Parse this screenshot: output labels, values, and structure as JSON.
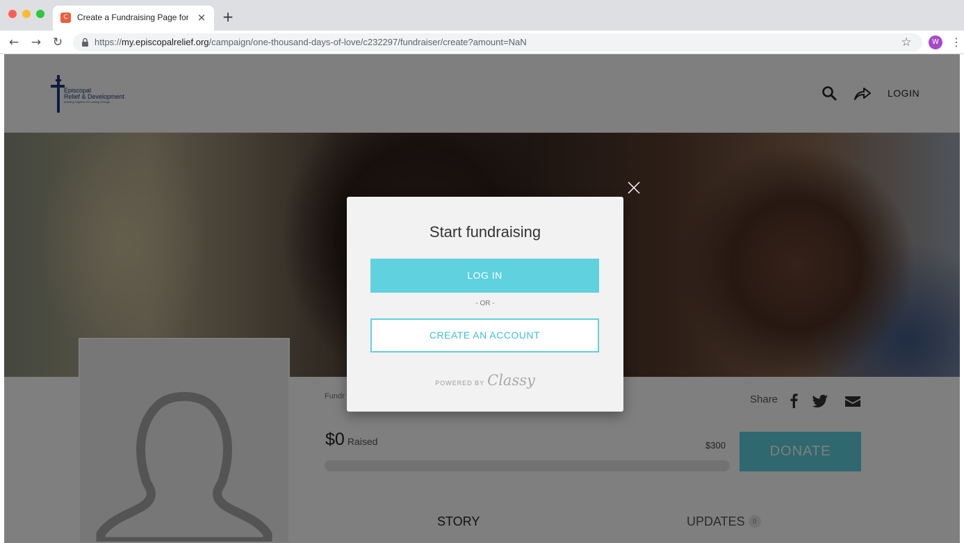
{
  "browser": {
    "tab_title": "Create a Fundraising Page for",
    "tab_close": "×",
    "new_tab": "+",
    "favicon_text": "C",
    "url_prefix": "https://",
    "url_domain": "my.episcopalrelief.org",
    "url_path": "/campaign/one-thousand-days-of-love/c232297/fundraiser/create?amount=NaN",
    "profile_initial": "W"
  },
  "header": {
    "logo_line1": "Episcopal",
    "logo_line2": "Relief & Development",
    "logo_tagline": "Working Together for Lasting Change",
    "login_label": "LOGIN"
  },
  "fundraiser": {
    "label": "Fundr",
    "share_label": "Share",
    "raised_amount": "$0",
    "raised_label": "Raised",
    "goal": "$300",
    "progress_fraction": 0,
    "donate_label": "DONATE"
  },
  "tabs": {
    "story": "STORY",
    "updates": "UPDATES",
    "updates_count": "0"
  },
  "modal": {
    "title": "Start fundraising",
    "login_button": "LOG IN",
    "or_text": "- OR -",
    "create_button": "CREATE AN ACCOUNT",
    "powered_by": "POWERED BY",
    "powered_brand": "Classy"
  },
  "colors": {
    "accent": "#5fd1df",
    "brand_navy": "#1d3a7a",
    "profile_avatar": "#a64cc7"
  },
  "icons": {
    "search": "search-icon",
    "share": "share-arrow-icon",
    "facebook": "facebook-icon",
    "twitter": "twitter-icon",
    "email": "email-icon",
    "close": "close-icon",
    "lock": "lock-icon",
    "star": "star-icon",
    "silhouette": "avatar-silhouette-icon"
  }
}
